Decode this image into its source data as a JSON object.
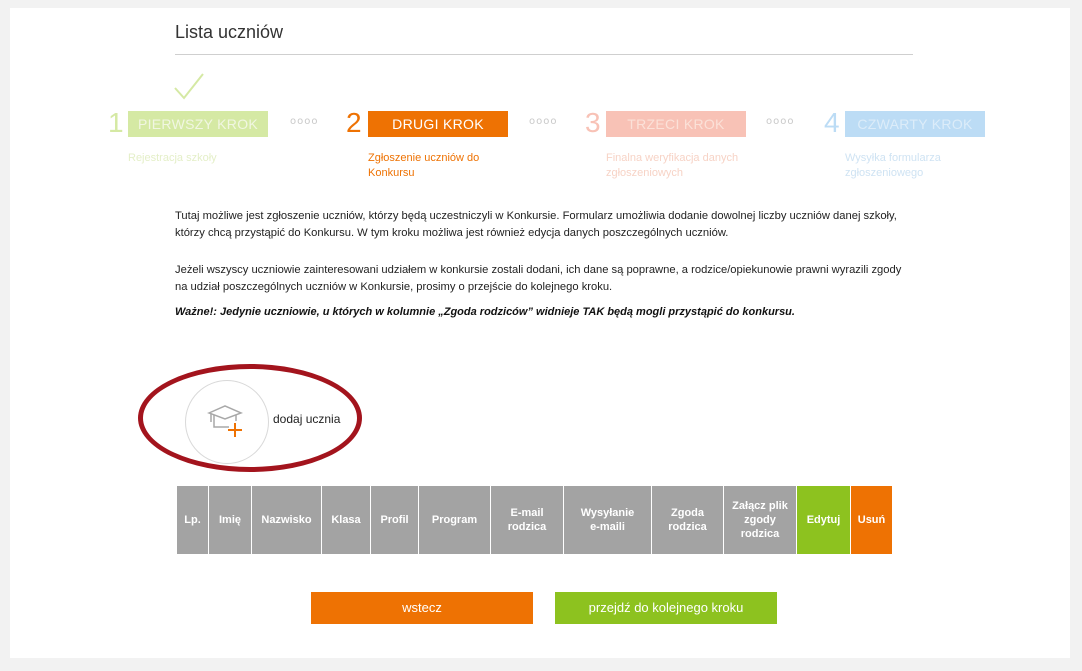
{
  "page": {
    "title": "Lista uczniów"
  },
  "steps": [
    {
      "number": "1",
      "label": "PIERWSZY KROK",
      "description": "Rejestracja szkoły",
      "color": "#d5e9a4",
      "text_color": "#f1f6e2"
    },
    {
      "number": "2",
      "label": "DRUGI KROK",
      "description": "Zgłoszenie uczniów do Konkursu",
      "color": "#ee7203",
      "text_color": "#ee7203"
    },
    {
      "number": "3",
      "label": "TRZECI KROK",
      "description": "Finalna weryfikacja danych zgłoszeniowych",
      "color": "#f8c2b6",
      "text_color": "#fbe1d8"
    },
    {
      "number": "4",
      "label": "CZWARTY KROK",
      "description": "Wysyłka formularza zgłoszeniowego",
      "color": "#bcdcf5",
      "text_color": "#dcecf9"
    }
  ],
  "step_dots": "oooo",
  "intro": {
    "paragraph1": "Tutaj możliwe jest zgłoszenie uczniów, którzy będą uczestniczyli w Konkursie. Formularz umożliwia dodanie dowolnej liczby uczniów danej szkoły, którzy chcą przystąpić do Konkursu. W tym kroku możliwa jest również edycja danych poszczególnych uczniów.",
    "paragraph2": "Jeżeli wszyscy uczniowie zainteresowani udziałem w konkursie zostali dodani, ich dane są poprawne, a rodzice/opiekunowie prawni wyrazili zgody na udział poszczególnych uczniów w Konkursie, prosimy o przejście do kolejnego kroku.",
    "warning": "Ważne!: Jedynie uczniowie, u których w kolumnie „Zgoda rodziców” widnieje TAK będą mogli przystąpić do konkursu."
  },
  "add_student": {
    "label": "dodaj ucznia",
    "icon": "graduation-cap-plus-icon"
  },
  "table": {
    "columns": [
      "Lp.",
      "Imię",
      "Nazwisko",
      "Klasa",
      "Profil",
      "Program",
      "E-mail rodzica",
      "Wysyłanie e-maili",
      "Zgoda rodzica",
      "Załącz plik zgody rodzica",
      "Edytuj",
      "Usuń"
    ]
  },
  "buttons": {
    "back": "wstecz",
    "next": "przejdź do kolejnego kroku"
  },
  "colors": {
    "orange": "#ee7203",
    "green": "#8dc21f",
    "header_gray": "#a3a3a3",
    "annotation_red": "#a3141d"
  }
}
